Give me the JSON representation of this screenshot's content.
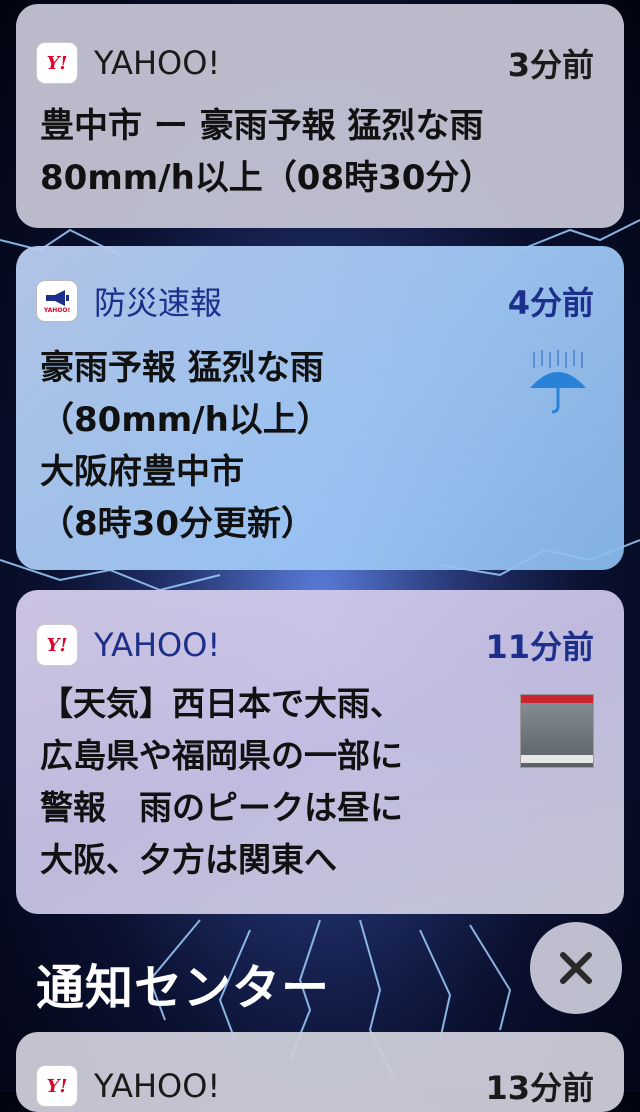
{
  "notifications": [
    {
      "app_name": "YAHOO!",
      "icon_text": "Y!",
      "icon": "yahoo-icon",
      "time": "3分前",
      "body": [
        "豊中市 ー 豪雨予報 猛烈な雨",
        "80mm/h以上（08時30分）"
      ]
    },
    {
      "app_name": "防災速報",
      "icon_text": "YAHOO!",
      "icon": "disaster-alert-icon",
      "time": "4分前",
      "body": [
        "豪雨予報 猛烈な雨",
        "（80mm/h以上）",
        "大阪府豊中市",
        "（8時30分更新）"
      ],
      "thumbnail": "rain-umbrella-icon"
    },
    {
      "app_name": "YAHOO!",
      "icon_text": "Y!",
      "icon": "yahoo-icon",
      "time": "11分前",
      "body": [
        "【天気】西日本で大雨、",
        "広島県や福岡県の一部に",
        "警報　雨のピークは昼に",
        "大阪、夕方は関東へ"
      ],
      "thumbnail": "news-video-thumbnail"
    },
    {
      "app_name": "YAHOO!",
      "icon_text": "Y!",
      "icon": "yahoo-icon",
      "time": "13分前"
    }
  ],
  "notification_center": {
    "title": "通知センター",
    "close_icon": "close-icon"
  },
  "colors": {
    "yahoo_red": "#e0002a",
    "accent_blue": "#1c2f8a",
    "text_dark": "#111111"
  }
}
